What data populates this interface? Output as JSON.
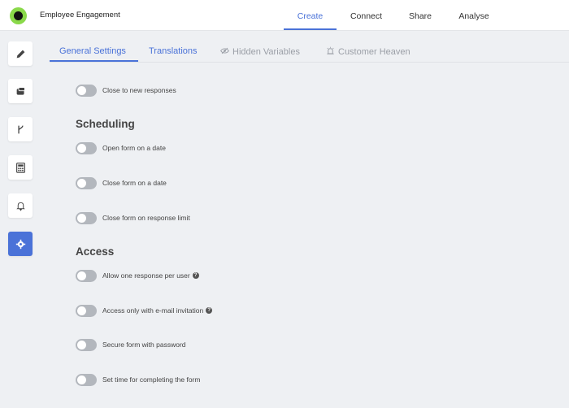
{
  "app": {
    "form_title": "Employee Engagement"
  },
  "nav": {
    "tabs": [
      {
        "label": "Create",
        "active": true
      },
      {
        "label": "Connect"
      },
      {
        "label": "Share"
      },
      {
        "label": "Analyse"
      }
    ]
  },
  "sidebar": {
    "items": [
      {
        "icon": "pencil-icon"
      },
      {
        "icon": "design-icon"
      },
      {
        "icon": "branch-icon"
      },
      {
        "icon": "calculator-icon"
      },
      {
        "icon": "bell-icon"
      },
      {
        "icon": "gear-icon",
        "active": true
      }
    ]
  },
  "subtabs": [
    {
      "label": "General Settings",
      "active": true
    },
    {
      "label": "Translations"
    },
    {
      "label": "Hidden Variables",
      "icon": "eye-slash-icon"
    },
    {
      "label": "Customer Heaven",
      "icon": "alarm-icon"
    }
  ],
  "settings": {
    "close_new_responses": "Close to new responses",
    "scheduling_heading": "Scheduling",
    "open_on_date": "Open form on a date",
    "close_on_date": "Close form on a date",
    "close_on_limit": "Close form on response limit",
    "access_heading": "Access",
    "one_response": "Allow one response per user",
    "email_invitation": "Access only with e-mail invitation",
    "password": "Secure form with password",
    "time_limit": "Set time for completing the form",
    "help_glyph": "?"
  },
  "colors": {
    "accent": "#4a72d8",
    "brand": "#8ad94a",
    "toggle_off": "#b3b7bd"
  }
}
